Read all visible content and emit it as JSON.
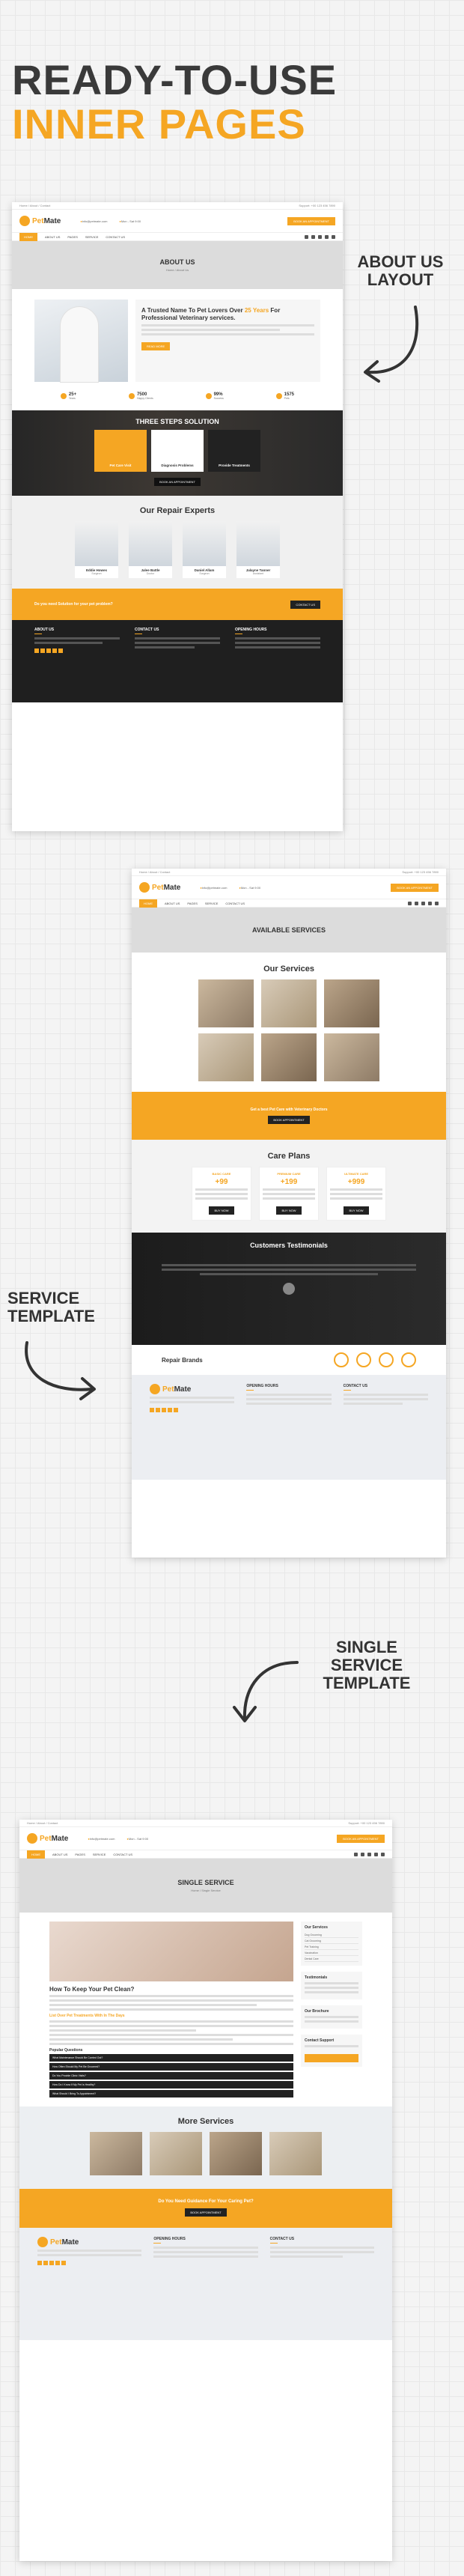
{
  "hero": {
    "line1": "READY-TO-USE",
    "line2": "INNER PAGES"
  },
  "labels": {
    "about": "ABOUT US\nLAYOUT",
    "service": "SERVICE\nTEMPLATE",
    "single": "SINGLE\nSERVICE\nTEMPLATE"
  },
  "colors": {
    "accent": "#f5a623",
    "dark": "#222222",
    "text": "#3a3a3a"
  },
  "site": {
    "logo_a": "Pet",
    "logo_b": "Mate",
    "nav": [
      "HOME",
      "ABOUT US",
      "PAGES",
      "SERVICE",
      "CONTACT US"
    ],
    "cta": "BOOK AN APPOINTMENT"
  },
  "about_page": {
    "title": "ABOUT US",
    "crumb": "Home / About Us",
    "heading_a": "A Trusted Name To Pet Lovers Over",
    "heading_accent": "25 Years",
    "heading_b": "For Professional Veterinary services.",
    "btn": "READ MORE",
    "stats": [
      {
        "value": "25+",
        "label": "Years"
      },
      {
        "value": "7500",
        "label": "Happy Clients"
      },
      {
        "value": "99%",
        "label": "Success"
      },
      {
        "value": "1575",
        "label": "Pets"
      }
    ],
    "steps_title": "THREE STEPS SOLUTION",
    "steps": [
      "Pet Care Visit",
      "Diagnosis Problems",
      "Provide Treatments"
    ],
    "steps_btn": "BOOK AN APPOINTMENT",
    "experts_title": "Our Repair Experts",
    "experts": [
      {
        "name": "Eddie Howes",
        "role": "Surgeon"
      },
      {
        "name": "Jalee Battle",
        "role": "Doctor"
      },
      {
        "name": "Daniel Allam",
        "role": "Surgeon"
      },
      {
        "name": "Jalayne Tanner",
        "role": "Assistant"
      }
    ],
    "cta_title": "Do you need Solution for your pet problem?",
    "cta_btn": "CONTACT US",
    "footer": [
      "ABOUT US",
      "CONTACT US",
      "OPENING HOURS"
    ]
  },
  "service_page": {
    "title": "AVAILABLE SERVICES",
    "services_title": "Our Services",
    "banner": "Get a best Pet Care with Veterinary Doctors",
    "banner_btn": "BOOK APPOINTMENT",
    "care_title": "Care Plans",
    "plans": [
      {
        "name": "BASIC CARE",
        "price": "+99"
      },
      {
        "name": "PREMIUM CARE",
        "price": "+199"
      },
      {
        "name": "ULTIMATE CARE",
        "price": "+999"
      }
    ],
    "plan_btn": "BUY NOW",
    "testi_title": "Customers Testimonials",
    "brands_title": "Repair Brands",
    "footer": [
      "OPENING HOURS",
      "CONTACT US"
    ]
  },
  "single_page": {
    "title": "SINGLE SERVICE",
    "crumb": "Home / Single Service",
    "heading": "How To Keep Your Pet Clean?",
    "sub1": "List Over Pet Treatments With In The Days",
    "sub2": "Popular Questions",
    "faqs": [
      "What Maintenance Should Be Carried Out?",
      "How Often Should My Pet Be Groomed?",
      "Do You Provide Clinic Visits?",
      "How Do I Know If My Pet Is Healthy?",
      "What Should I Bring To Appointment?"
    ],
    "side_services": "Our Services",
    "side_list": [
      "Dog Grooming",
      "Cat Grooming",
      "Pet Training",
      "Vaccination",
      "Dental Care"
    ],
    "side_testi": "Testimonials",
    "side_brochure": "Our Brochure",
    "side_support": "Contact Support",
    "more_title": "More Services",
    "cta_title": "Do You Need Guidance For Your Caring Pet?",
    "cta_btn": "BOOK APPOINTMENT",
    "footer": [
      "OPENING HOURS",
      "CONTACT US"
    ]
  }
}
